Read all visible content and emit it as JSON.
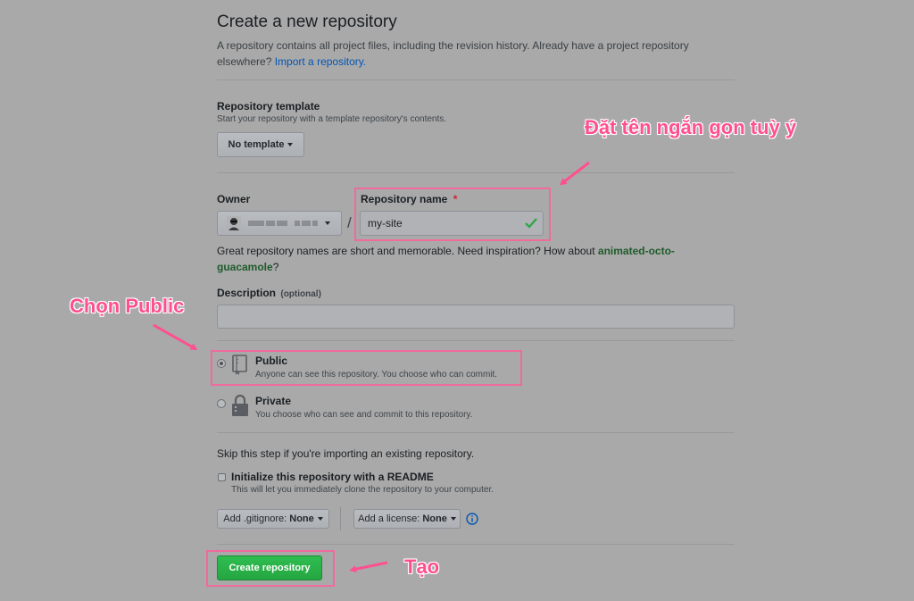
{
  "header": {
    "title": "Create a new repository",
    "description": "A repository contains all project files, including the revision history. Already have a project repository elsewhere?",
    "import_link": "Import a repository."
  },
  "template": {
    "label": "Repository template",
    "note": "Start your repository with a template repository's contents.",
    "button": "No template"
  },
  "owner": {
    "label": "Owner",
    "separator": "/"
  },
  "repo_name": {
    "label": "Repository name",
    "required_mark": "*",
    "value": "my-site"
  },
  "name_hint": {
    "text": "Great repository names are short and memorable. Need inspiration? How about",
    "suggestion": "animated-octo-guacamole",
    "end": "?"
  },
  "description": {
    "label": "Description",
    "optional": "(optional)",
    "value": ""
  },
  "visibility": {
    "public": {
      "label": "Public",
      "note": "Anyone can see this repository. You choose who can commit.",
      "selected": true
    },
    "private": {
      "label": "Private",
      "note": "You choose who can see and commit to this repository.",
      "selected": false
    }
  },
  "init": {
    "skip_note": "Skip this step if you're importing an existing repository.",
    "readme_label": "Initialize this repository with a README",
    "readme_note": "This will let you immediately clone the repository to your computer.",
    "readme_checked": false,
    "gitignore_prefix": "Add .gitignore:",
    "gitignore_value": "None",
    "license_prefix": "Add a license:",
    "license_value": "None"
  },
  "submit": {
    "label": "Create repository"
  },
  "annotations": {
    "name_tip": "Đặt tên ngắn gọn tuỳ ý",
    "public_tip": "Chọn Public",
    "create_tip": "Tạo"
  },
  "colors": {
    "annotation": "#ff4f8f",
    "primary_button": "#28a745",
    "link": "#0366d6",
    "suggestion": "#1e5b2a"
  }
}
